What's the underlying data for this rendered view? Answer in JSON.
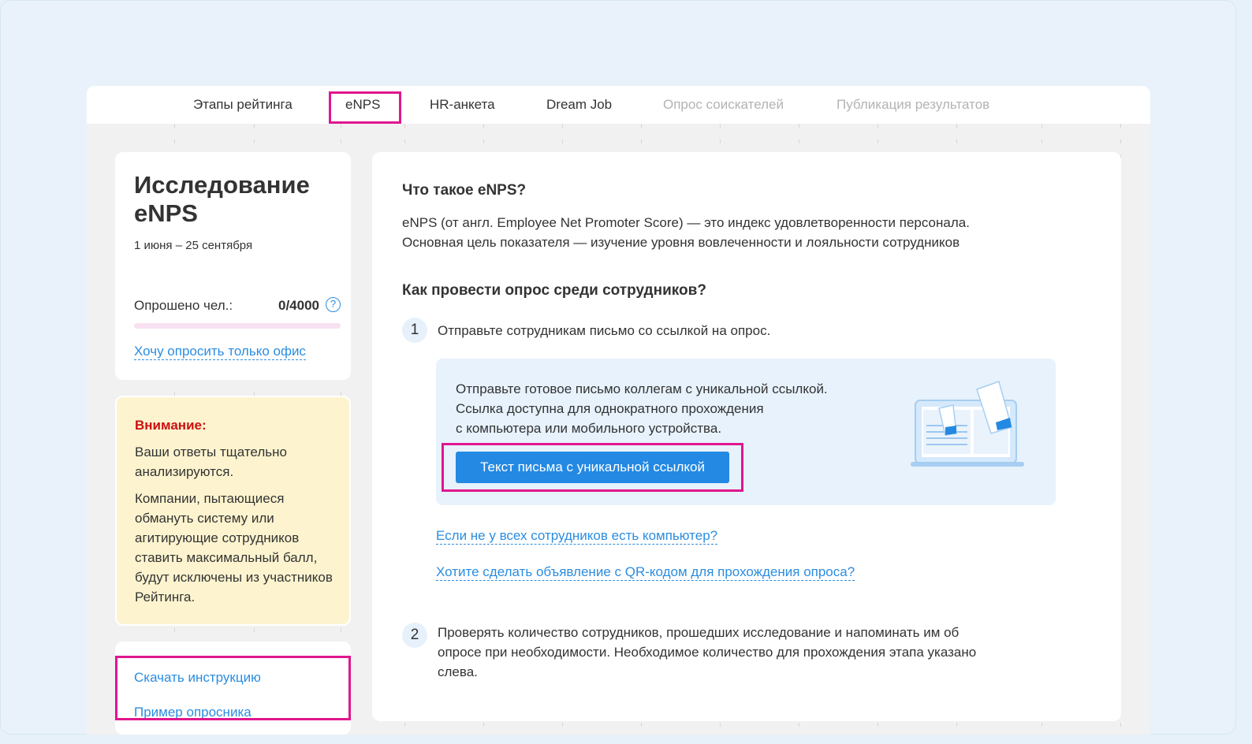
{
  "tabs": [
    {
      "label": "Этапы рейтинга",
      "active": false,
      "disabled": false
    },
    {
      "label": "eNPS",
      "active": true,
      "disabled": false
    },
    {
      "label": "HR-анкета",
      "active": false,
      "disabled": false
    },
    {
      "label": "Dream Job",
      "active": false,
      "disabled": false
    },
    {
      "label": "Опрос соискателей",
      "active": false,
      "disabled": true
    },
    {
      "label": "Публикация результатов",
      "active": false,
      "disabled": true
    }
  ],
  "study": {
    "title": "Исследование eNPS",
    "dates": "1 июня – 25 сентября",
    "polled_label": "Опрошено чел.:",
    "polled_value": "0/4000",
    "help_icon": "?",
    "progress_fraction": 0,
    "office_link": "Хочу опросить только офис"
  },
  "warning": {
    "title": "Внимание:",
    "text1": "Ваши ответы тщательно анализируются.",
    "text2": "Компании, пытающиеся обмануть систему или агитирующие сотрудников ставить максимальный балл, будут исключены из участников Рейтинга."
  },
  "links": {
    "download_instruction": "Скачать инструкцию",
    "sample_survey": "Пример опросника"
  },
  "main": {
    "what_title": "Что такое eNPS?",
    "what_text1": "eNPS (от англ. Employee Net Promoter Score) — это индекс удовлетворенности персонала.",
    "what_text2": "Основная цель показателя — изучение уровня вовлеченности и лояльности сотрудников",
    "how_title": "Как провести опрос среди сотрудников?",
    "step1_num": "1",
    "step1_text": "Отправьте сотрудникам письмо со ссылкой на опрос.",
    "infobox_line1": "Отправьте готовое письмо коллегам с уникальной ссылкой.",
    "infobox_line2": "Ссылка доступна для однократного прохождения",
    "infobox_line3": "с компьютера или мобильного устройства.",
    "infobox_button": "Текст письма с уникальной ссылкой",
    "link_no_computer": "Если не у всех сотрудников есть компьютер?",
    "link_qr": "Хотите сделать объявление с QR-кодом для прохождения опроса?",
    "step2_num": "2",
    "step2_text": "Проверять количество сотрудников, прошедших исследование и напоминать им об опросе при необходимости. Необходимое количество для прохождения этапа указано слева."
  },
  "colors": {
    "accent": "#2389e3",
    "highlight": "#e0178e",
    "warning_bg": "#fdf4cf",
    "warning_title": "#cc1010"
  }
}
